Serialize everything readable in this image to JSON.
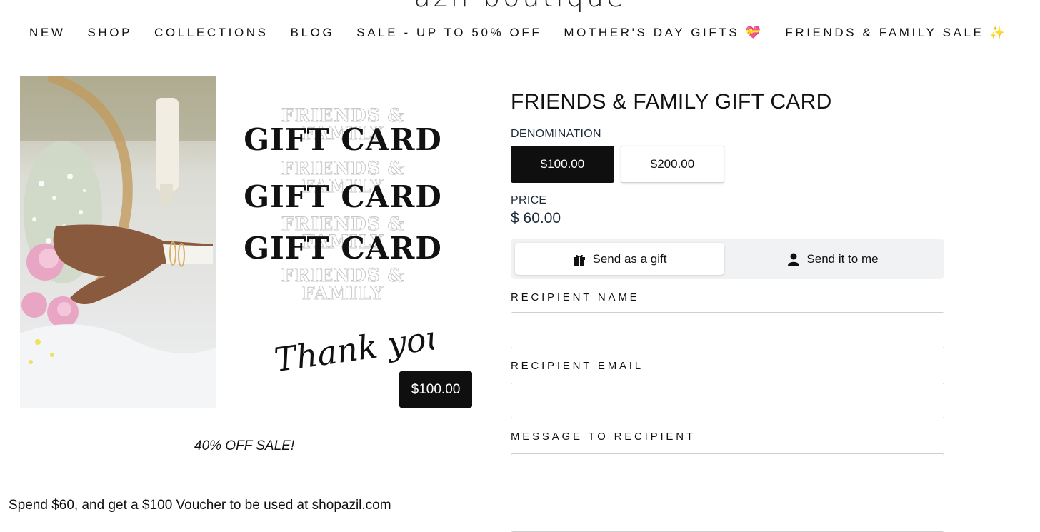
{
  "brand": {
    "name": "azil boutique"
  },
  "nav": {
    "items": [
      {
        "label": "NEW"
      },
      {
        "label": "SHOP"
      },
      {
        "label": "COLLECTIONS"
      },
      {
        "label": "BLOG"
      },
      {
        "label": "SALE - UP TO 50% OFF"
      },
      {
        "label": "MOTHER'S DAY GIFTS 💝"
      },
      {
        "label": "FRIENDS & FAMILY SALE ✨"
      }
    ]
  },
  "product_image": {
    "outline_line": "FRIENDS & FAMILY",
    "bold_line": "GIFT CARD",
    "thank_you": "Thank you!",
    "price_tag": "$100.00"
  },
  "promo_link": "40% OFF SALE!",
  "description": "Spend $60, and get a $100 Voucher to be used at shopazil.com",
  "product": {
    "title": "FRIENDS & FAMILY GIFT CARD",
    "denomination_label": "DENOMINATION",
    "denominations": [
      {
        "label": "$100.00",
        "selected": true
      },
      {
        "label": "$200.00",
        "selected": false
      }
    ],
    "price_label": "PRICE",
    "price": "$ 60.00"
  },
  "delivery_toggle": {
    "options": [
      {
        "label": "Send as a gift",
        "icon": "gift-icon",
        "selected": true
      },
      {
        "label": "Send it to me",
        "icon": "person-icon",
        "selected": false
      }
    ]
  },
  "form": {
    "recipient_name_label": "RECIPIENT NAME",
    "recipient_name_value": "",
    "recipient_email_label": "RECIPIENT EMAIL",
    "recipient_email_value": "",
    "message_label": "MESSAGE TO RECIPIENT",
    "message_value": ""
  }
}
